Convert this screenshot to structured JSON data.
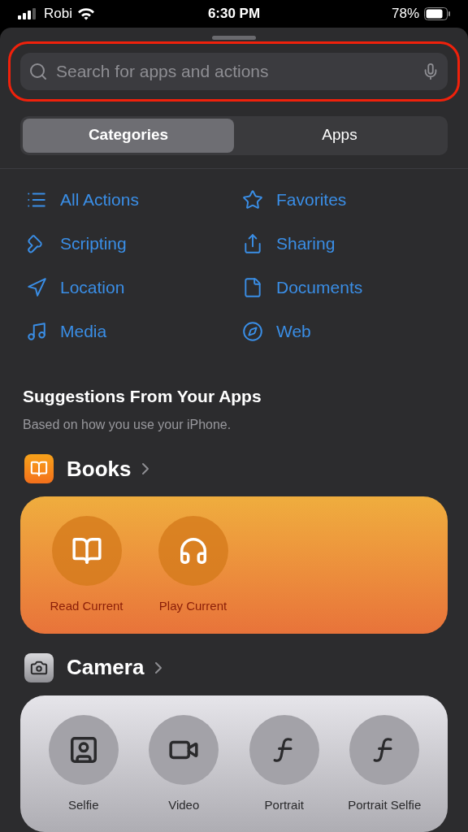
{
  "status_bar": {
    "carrier": "Robi",
    "time": "6:30 PM",
    "battery": "78%"
  },
  "search": {
    "placeholder": "Search for apps and actions"
  },
  "tabs": [
    {
      "label": "Categories",
      "selected": true
    },
    {
      "label": "Apps",
      "selected": false
    }
  ],
  "categories": [
    {
      "label": "All Actions"
    },
    {
      "label": "Favorites"
    },
    {
      "label": "Scripting"
    },
    {
      "label": "Sharing"
    },
    {
      "label": "Location"
    },
    {
      "label": "Documents"
    },
    {
      "label": "Media"
    },
    {
      "label": "Web"
    }
  ],
  "suggestions": {
    "title": "Suggestions From Your Apps",
    "subtitle": "Based on how you use your iPhone."
  },
  "apps": [
    {
      "name": "Books",
      "kind": "books",
      "actions": [
        {
          "label": "Read Current"
        },
        {
          "label": "Play Current"
        }
      ]
    },
    {
      "name": "Camera",
      "kind": "camera",
      "actions": [
        {
          "label": "Selfie"
        },
        {
          "label": "Video"
        },
        {
          "label": "Portrait"
        },
        {
          "label": "Portrait Selfie"
        }
      ]
    }
  ]
}
